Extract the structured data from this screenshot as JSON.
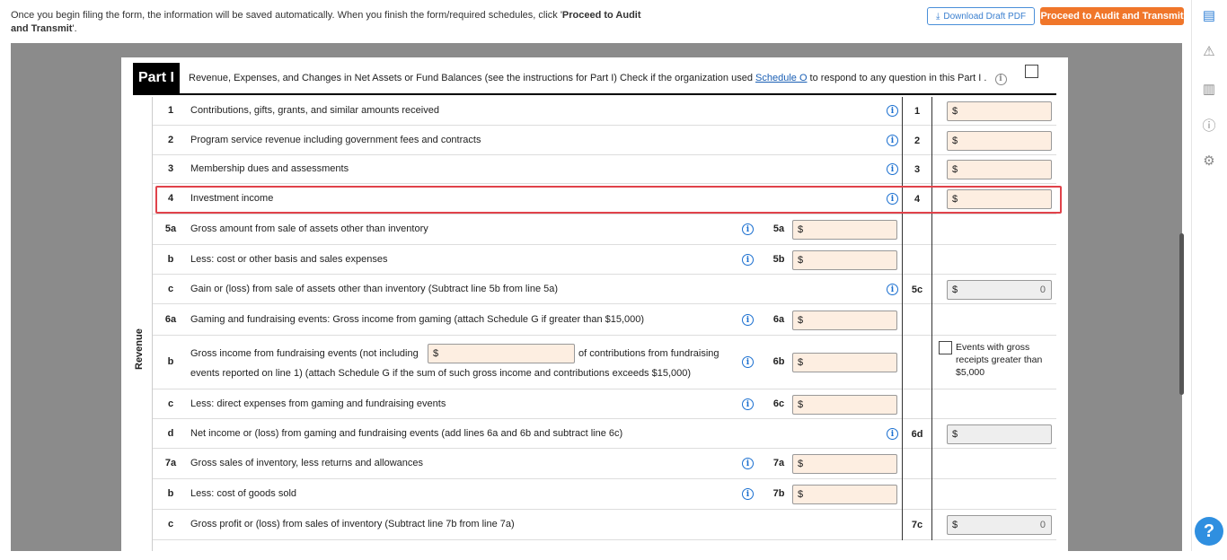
{
  "topbar": {
    "message_prefix": "Once you begin filing the form, the information will be saved automatically. When you finish the form/required schedules, click '",
    "message_bold": "Proceed to Audit and Transmit",
    "message_suffix": "'.",
    "download_label": "Download Draft PDF",
    "proceed_label": "Proceed to Audit and Transmit"
  },
  "part": {
    "label": "Part I",
    "title_prefix": "Revenue, Expenses, and Changes in Net Assets or Fund Balances (see the instructions for Part I) Check if the organization used ",
    "title_link": "Schedule O",
    "title_suffix": " to respond to any question in this Part I ."
  },
  "side_label": "Revenue",
  "rows": [
    {
      "num": "1",
      "desc": "Contributions, gifts, grants, and similar amounts received",
      "box": "1",
      "currency": "$"
    },
    {
      "num": "2",
      "desc": "Program service revenue including government fees and contracts",
      "box": "2",
      "currency": "$"
    },
    {
      "num": "3",
      "desc": "Membership dues and assessments",
      "box": "3",
      "currency": "$"
    },
    {
      "num": "4",
      "desc": "Investment income",
      "box": "4",
      "currency": "$"
    },
    {
      "num": "5a",
      "desc": "Gross amount from sale of assets other than inventory",
      "box": "5a",
      "currency": "$"
    },
    {
      "num": "b",
      "desc": "Less: cost or other basis and sales expenses",
      "box": "5b",
      "currency": "$"
    },
    {
      "num": "c",
      "desc": "Gain or (loss) from sale of assets other than inventory (Subtract line 5b from line 5a)",
      "box": "5c",
      "currency": "$",
      "value": "0"
    },
    {
      "num": "6a",
      "desc": "Gaming and fundraising events: Gross income from gaming (attach Schedule G if greater than $15,000)",
      "box": "6a",
      "currency": "$"
    },
    {
      "num": "b",
      "desc1": "Gross income from fundraising events (not including",
      "desc1b": "of contributions from fundraising",
      "desc2": "events reported on line 1) (attach Schedule G if the sum of such gross income and contributions exceeds $15,000)",
      "box": "6b",
      "currency": "$",
      "inline_currency": "$"
    },
    {
      "num": "c",
      "desc": "Less: direct expenses from gaming and fundraising events",
      "box": "6c",
      "currency": "$"
    },
    {
      "num": "d",
      "desc": "Net income or (loss) from gaming and fundraising events (add lines 6a and 6b and subtract line 6c)",
      "box": "6d",
      "currency": "$"
    },
    {
      "num": "7a",
      "desc": "Gross sales of inventory, less returns and allowances",
      "box": "7a",
      "currency": "$"
    },
    {
      "num": "b",
      "desc": "Less: cost of goods sold",
      "box": "7b",
      "currency": "$"
    },
    {
      "num": "c",
      "desc": "Gross profit or (loss) from sales of inventory (Subtract line 7b from line 7a)",
      "box": "7c",
      "currency": "$",
      "value": "0"
    }
  ],
  "events_checkbox_label": "Events with gross receipts greater than $5,000",
  "info_glyph": "i"
}
